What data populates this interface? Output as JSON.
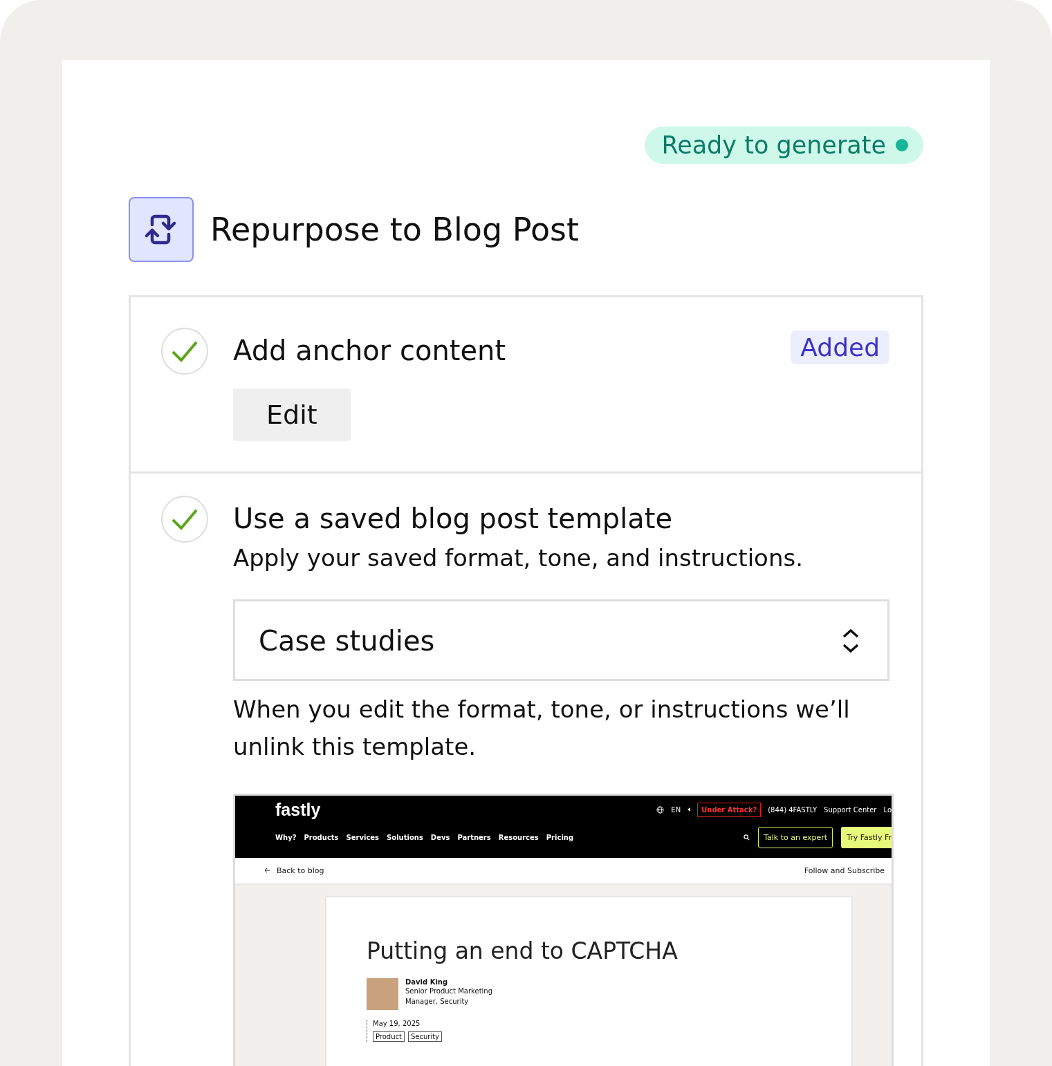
{
  "status_badge": {
    "label": "Ready to generate"
  },
  "header": {
    "title": "Repurpose to Blog Post"
  },
  "anchor_step": {
    "title": "Add anchor content",
    "checked": true,
    "badge": "Added",
    "edit_button": "Edit"
  },
  "template_step": {
    "title": "Use a saved blog post template",
    "checked": true,
    "description": "Apply your saved format, tone, and instructions.",
    "select": {
      "value": "Case studies"
    },
    "note": "When you edit the format, tone, or instructions we’ll unlink this template.",
    "preview": {
      "logo": "fastly",
      "language": "EN",
      "alert_button": "Under Attack?",
      "phone": "(844) 4FASTLY",
      "support_link": "Support Center",
      "login_link": "Lo",
      "nav": [
        "Why?",
        "Products",
        "Services",
        "Solutions",
        "Devs",
        "Partners",
        "Resources",
        "Pricing"
      ],
      "expert_button": "Talk to an expert",
      "trial_button": "Try Fastly Fr",
      "back_link": "Back to blog",
      "follow_link": "Follow and Subscribe",
      "article": {
        "title": "Putting an end to CAPTCHA",
        "author": "David King",
        "author_role": "Senior Product Marketing Manager, Security",
        "date": "May 19, 2025",
        "tags": [
          "Product",
          "Security"
        ]
      }
    }
  }
}
